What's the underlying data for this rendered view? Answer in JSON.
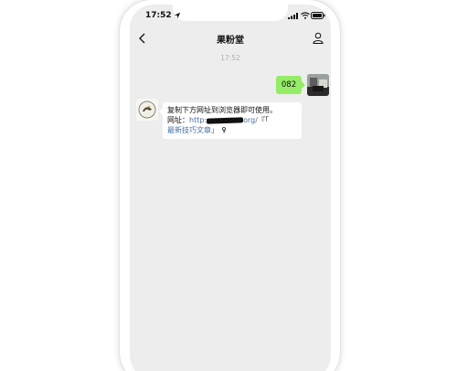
{
  "status_bar": {
    "time": "17:52",
    "location_icon": "location-arrow-icon",
    "signal_icon": "cellular-signal-icon",
    "wifi_icon": "wifi-icon",
    "battery_icon": "battery-icon"
  },
  "nav": {
    "back_icon": "chevron-left-icon",
    "title": "果粉堂",
    "profile_icon": "person-icon"
  },
  "chat": {
    "timestamp": "17:52",
    "outgoing": {
      "text": "082"
    },
    "incoming": {
      "line1": "复制下方网址到浏览器即可使用。",
      "line2_prefix": "网址：",
      "url_start": "http:",
      "url_end": "org/",
      "quote_open": "『「",
      "link_text": "最新技巧文章」",
      "tail_icon": "key-icon"
    }
  },
  "colors": {
    "chat_bg": "#ededed",
    "outgoing_bubble": "#95ec69",
    "incoming_bubble": "#ffffff",
    "link": "#4a6fa5"
  }
}
